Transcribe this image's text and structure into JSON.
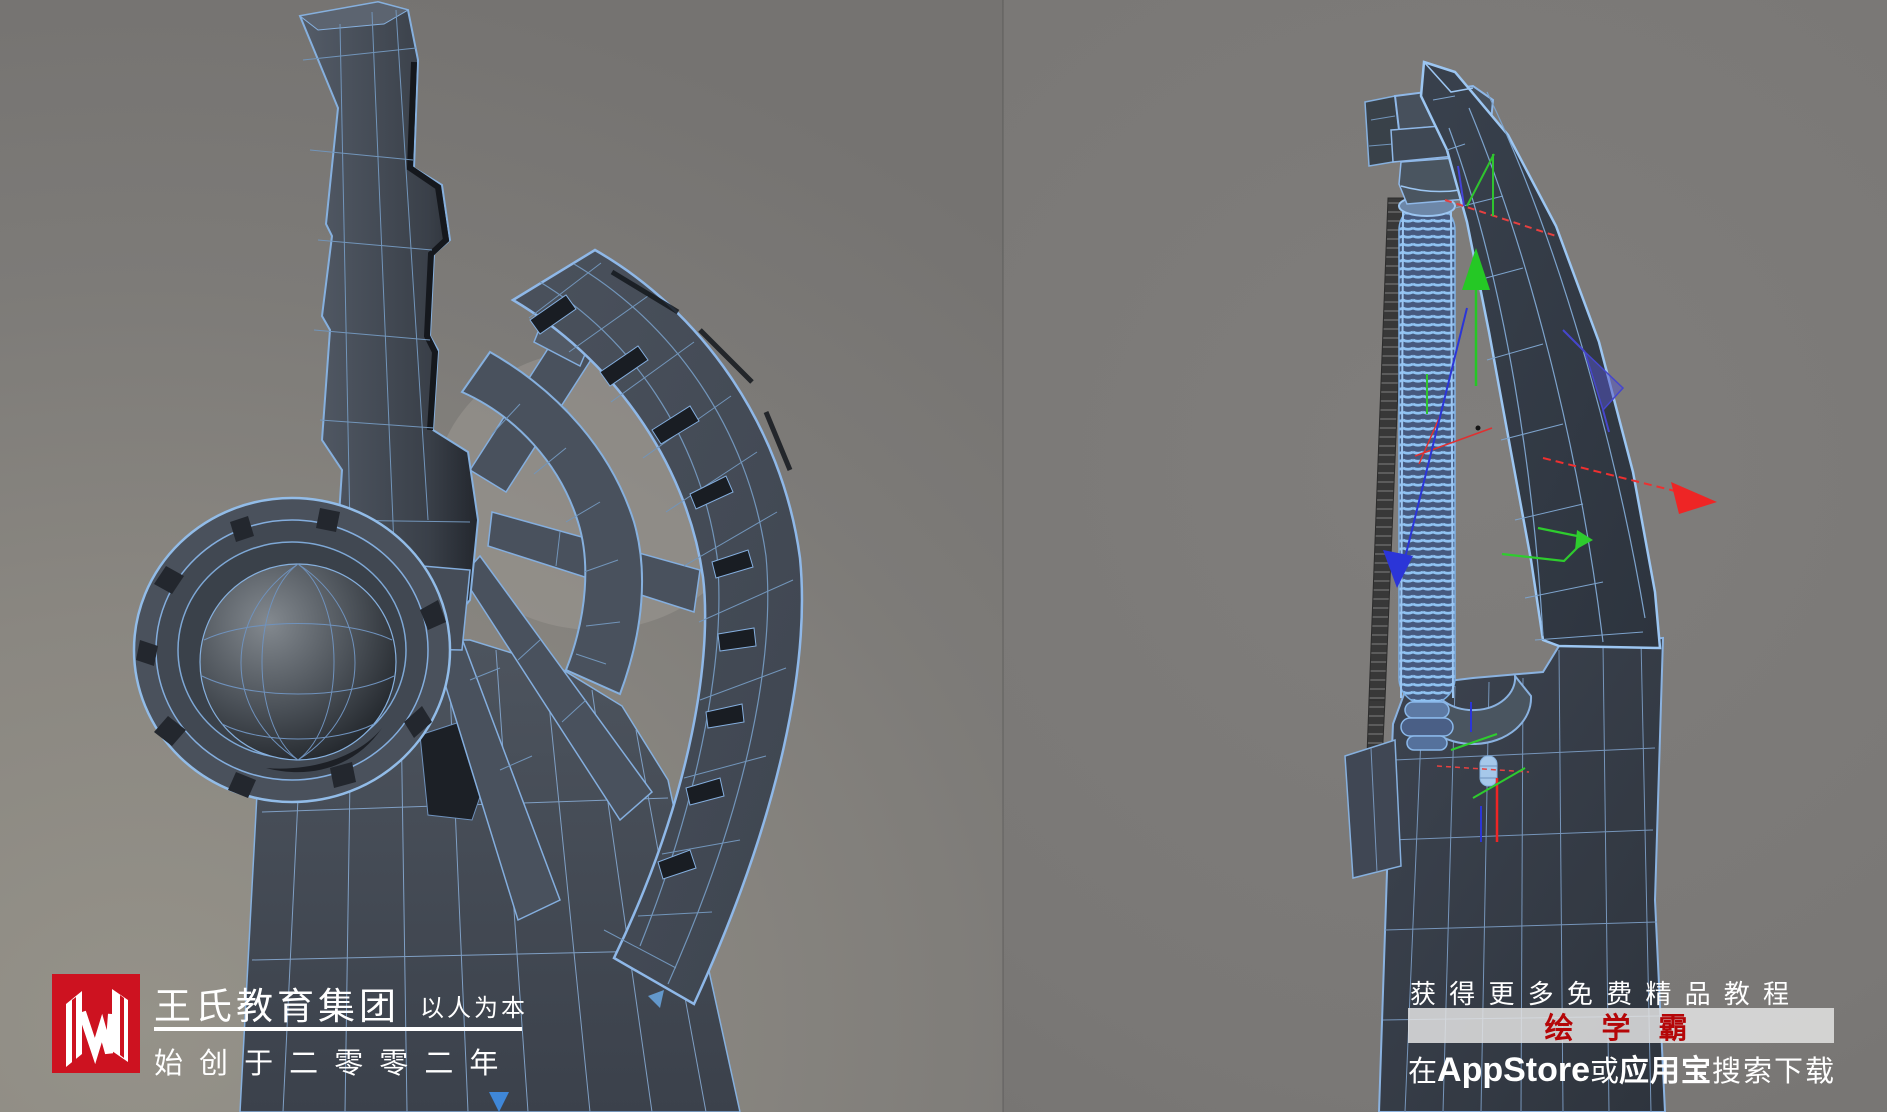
{
  "app": {
    "description": "3D modeling viewport screenshot, two camera views of a wireframe sci-fi sword model",
    "left_view": "perspective view of hilt with fan-shaped guard and dome pommel",
    "right_view": "perspective view of blade spine with coiled column"
  },
  "watermark_left": {
    "logo_letter": "W",
    "logo_color": "#cd1220",
    "company": "王氏教育集团",
    "slogan": "以人为本",
    "founded": "始 创 于 二 零 零 二 年"
  },
  "watermark_right": {
    "line1": "获 得 更 多 免 费 精 品 教 程",
    "brand": "绘 学 霸",
    "brand_color": "#b50608",
    "download_prefix": "在",
    "store1": "AppStore",
    "conjunction": "或",
    "store2": "应用宝",
    "download_suffix": "搜索下载"
  },
  "viewport": {
    "wire_color": "#86b0de",
    "wire_bright": "#9cc6f2",
    "surface_color": "#3e4650",
    "background_left": "#8a8781",
    "background_right": "#7a7876",
    "gizmo_x_color": "#ee2525",
    "gizmo_y_color": "#25c825",
    "gizmo_z_color": "#2b35d8"
  }
}
